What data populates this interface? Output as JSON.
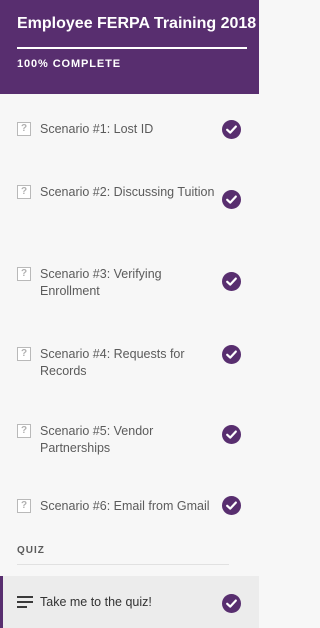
{
  "course": {
    "title": "Employee FERPA Training 2018",
    "progress_label": "100% COMPLETE"
  },
  "lessons": [
    {
      "label": "Scenario #1: Lost ID",
      "status": "complete"
    },
    {
      "label": "Scenario #2: Discussing Tuition",
      "status": "complete"
    },
    {
      "label": "Scenario #3: Verifying Enrollment",
      "status": "complete"
    },
    {
      "label": "Scenario #4: Requests for Records",
      "status": "complete"
    },
    {
      "label": "Scenario #5: Vendor Partnerships",
      "status": "complete"
    },
    {
      "label": "Scenario #6: Email from Gmail",
      "status": "complete"
    }
  ],
  "quiz_section": {
    "heading": "QUIZ",
    "item_label": "Take me to the quiz!",
    "status": "complete"
  },
  "icons": {
    "lesson_icon": "question-mark-icon",
    "status_icon": "checkmark-circle-icon",
    "quiz_icon": "menu-lines-icon"
  },
  "colors": {
    "brand": "#582e6f",
    "sidebar_bg": "#f7f7f7",
    "active_item_bg": "#ececec"
  }
}
